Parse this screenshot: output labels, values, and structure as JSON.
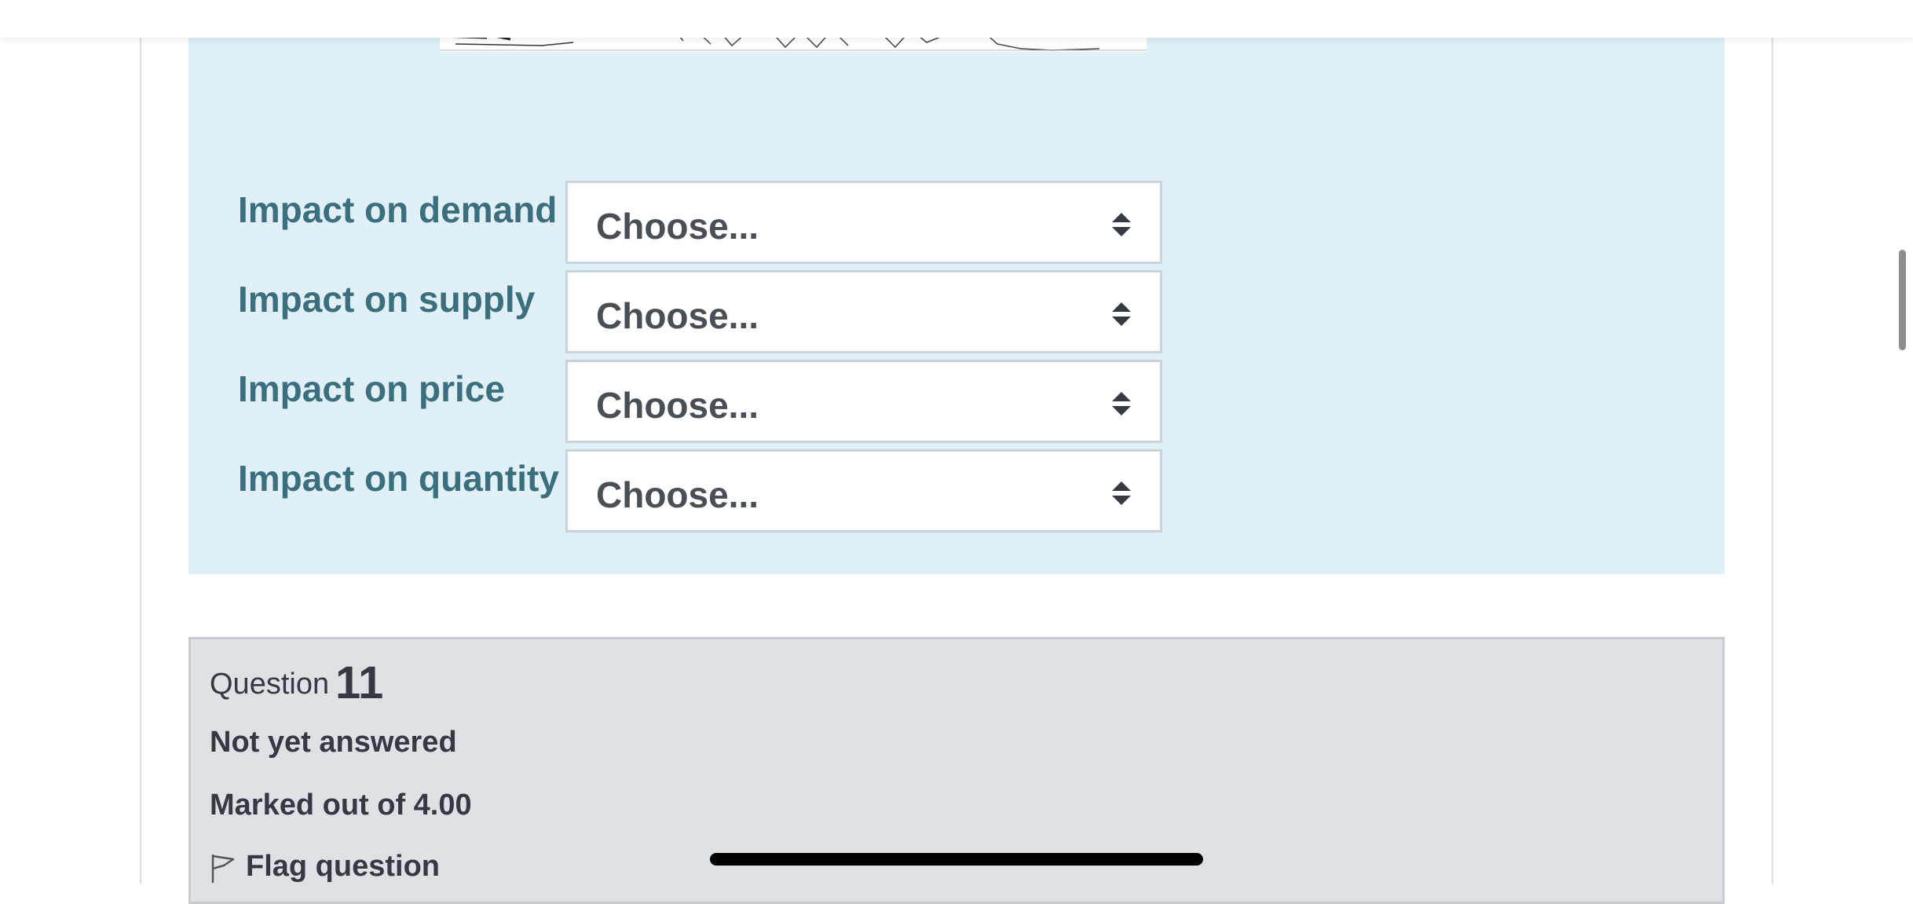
{
  "answers": [
    {
      "label": "Impact on demand",
      "selected": "Choose..."
    },
    {
      "label": "Impact on supply",
      "selected": "Choose..."
    },
    {
      "label": "Impact on price",
      "selected": "Choose..."
    },
    {
      "label": "Impact on quantity",
      "selected": "Choose..."
    }
  ],
  "question_info": {
    "prefix": "Question",
    "number": "11",
    "state": "Not yet answered",
    "grade": "Marked out of 4.00",
    "flag_label": "Flag question"
  },
  "icons": {
    "select_arrows": "sort-arrows-icon",
    "flag": "flag-icon"
  },
  "colors": {
    "content_bg": "#e1eff7",
    "label_text": "#3b6f7e",
    "info_bg": "#dee2e6"
  }
}
